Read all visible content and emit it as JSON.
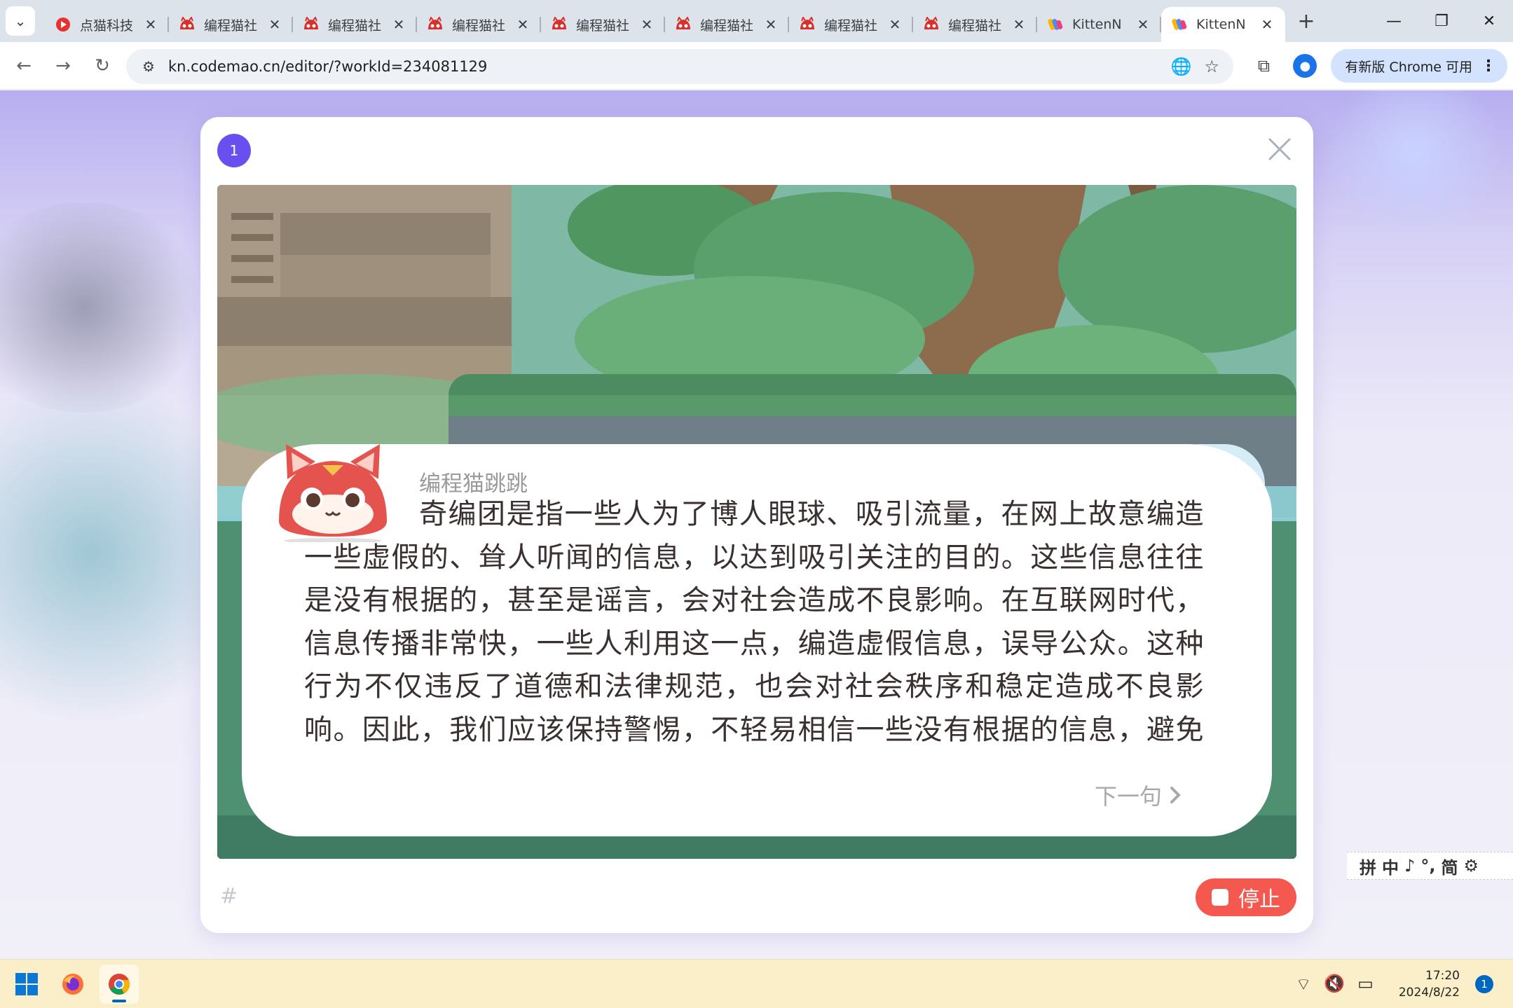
{
  "browser": {
    "tabs": [
      {
        "title": "点猫科技",
        "favicon": "dianmao-logo",
        "active": false
      },
      {
        "title": "编程猫社",
        "favicon": "codemao-cat-logo",
        "active": false
      },
      {
        "title": "编程猫社",
        "favicon": "codemao-cat-logo",
        "active": false
      },
      {
        "title": "编程猫社",
        "favicon": "codemao-cat-logo",
        "active": false
      },
      {
        "title": "编程猫社",
        "favicon": "codemao-cat-logo",
        "active": false
      },
      {
        "title": "编程猫社",
        "favicon": "codemao-cat-logo",
        "active": false
      },
      {
        "title": "编程猫社",
        "favicon": "codemao-cat-logo",
        "active": false
      },
      {
        "title": "编程猫社",
        "favicon": "codemao-cat-logo",
        "active": false
      },
      {
        "title": "KittenN",
        "favicon": "kitten-logo",
        "active": false
      },
      {
        "title": "KittenN",
        "favicon": "kitten-logo",
        "active": true
      }
    ],
    "url": "kn.codemao.cn/editor/?workId=234081129",
    "update_label": "有新版 Chrome 可用"
  },
  "modal": {
    "step": "1",
    "speaker": "编程猫跳跳",
    "text": "奇编团是指一些人为了博人眼球、吸引流量，在网上故意编造一些虚假的、耸人听闻的信息，以达到吸引关注的目的。这些信息往往是没有根据的，甚至是谣言，会对社会造成不良影响。在互联网时代，信息传播非常快，一些人利用这一点，编造虚假信息，误导公众。这种行为不仅违反了道德和法律规范，也会对社会秩序和稳定造成不良影响。因此，我们应该保持警惕，不轻易相信一些没有根据的信息，避免被",
    "next_label": "下一句",
    "stop_label": "停止"
  },
  "ime_bar": {
    "items": [
      "拼",
      "中",
      "♪",
      "°,",
      "简",
      "⚙"
    ]
  },
  "taskbar": {
    "time": "17:20",
    "date": "2024/8/22",
    "notifications": "1"
  },
  "colors": {
    "accent_purple": "#6a4ff0",
    "stop_red": "#f4584f",
    "tab_strip": "#dde3ea",
    "taskbar": "#fbefc9"
  }
}
